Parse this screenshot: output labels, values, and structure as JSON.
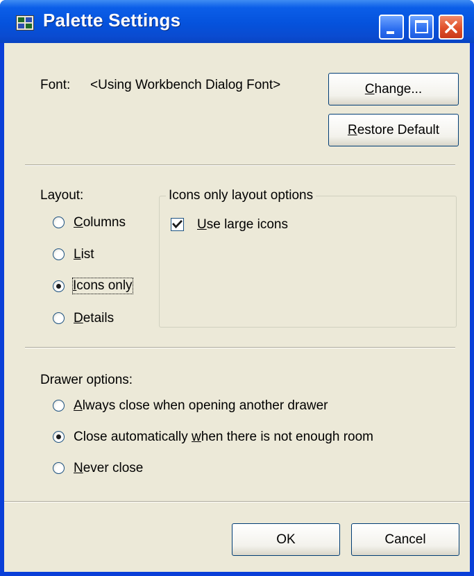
{
  "window": {
    "title": "Palette Settings"
  },
  "font_section": {
    "label": "Font:",
    "value": "<Using Workbench Dialog Font>",
    "change_button": {
      "pre": "",
      "mnemonic": "C",
      "post": "hange..."
    },
    "restore_button": {
      "pre": "",
      "mnemonic": "R",
      "post": "estore Default"
    }
  },
  "layout": {
    "label": "Layout:",
    "options": [
      {
        "pre": "",
        "mnemonic": "C",
        "post": "olumns",
        "selected": false
      },
      {
        "pre": "",
        "mnemonic": "L",
        "post": "ist",
        "selected": false
      },
      {
        "pre": "",
        "mnemonic": "I",
        "post": "cons only",
        "selected": true
      },
      {
        "pre": "",
        "mnemonic": "D",
        "post": "etails",
        "selected": false
      }
    ]
  },
  "icons_group": {
    "legend": "Icons only layout options",
    "use_large_icons": {
      "pre": "",
      "mnemonic": "U",
      "post": "se large icons",
      "checked": true
    }
  },
  "drawer": {
    "label": "Drawer options:",
    "options": [
      {
        "pre": "",
        "mnemonic": "A",
        "post": "lways close when opening another drawer",
        "selected": false
      },
      {
        "pre": "Close automatically ",
        "mnemonic": "w",
        "post": "hen there is not enough room",
        "selected": true
      },
      {
        "pre": "",
        "mnemonic": "N",
        "post": "ever close",
        "selected": false
      }
    ]
  },
  "footer": {
    "ok_label": "OK",
    "cancel_label": "Cancel"
  }
}
